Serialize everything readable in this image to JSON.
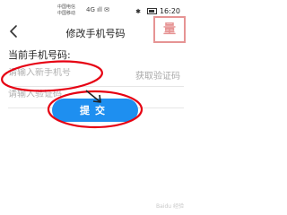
{
  "status_bar": {
    "carrier_1": "中国电信",
    "carrier_2": "中国移动",
    "network_icons": "4G ıll ✉",
    "bluetooth_icon": "bluetooth-icon",
    "battery_icon": "battery-icon",
    "time": "16:20"
  },
  "watermark": {
    "text": "量 "
  },
  "header": {
    "title": "修改手机号码",
    "back_icon": "back-arrow-icon"
  },
  "form": {
    "current_phone_label": "当前手机号码:",
    "new_phone_placeholder": "请输入新手机号",
    "new_phone_value": "",
    "get_code_label": "获取验证码",
    "code_placeholder": "请输入验证码",
    "code_value": "",
    "submit_label": "提交"
  },
  "credit": {
    "text": "Baidu 经验"
  },
  "colors": {
    "accent": "#1e8ff0",
    "annotation_red": "#e60012",
    "placeholder": "#b0b0b0"
  }
}
